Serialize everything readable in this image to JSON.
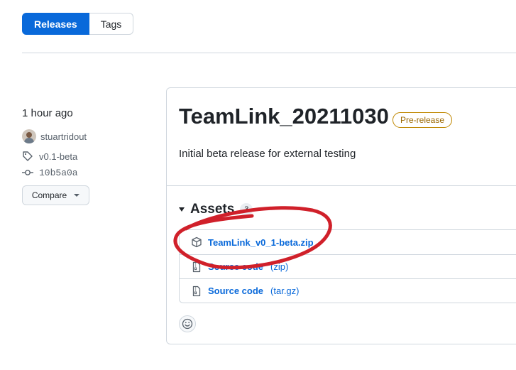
{
  "tabs": {
    "releases_label": "Releases",
    "tags_label": "Tags"
  },
  "sidebar": {
    "time": "1 hour ago",
    "author": "stuartridout",
    "tag": "v0.1-beta",
    "commit": "10b5a0a",
    "compare_label": "Compare"
  },
  "release": {
    "title": "TeamLink_20211030",
    "badge": "Pre-release",
    "description": "Initial beta release for external testing"
  },
  "assets": {
    "heading": "Assets",
    "count": "3",
    "items": [
      {
        "name": "TeamLink_v0_1-beta.zip",
        "suffix": "",
        "icon": "package-icon"
      },
      {
        "name": "Source code",
        "suffix": "(zip)",
        "icon": "file-zip-icon"
      },
      {
        "name": "Source code",
        "suffix": "(tar.gz)",
        "icon": "file-zip-icon"
      }
    ]
  },
  "colors": {
    "accent": "#0969da",
    "prerelease": "#9a6700",
    "annotation": "#d0202a"
  }
}
